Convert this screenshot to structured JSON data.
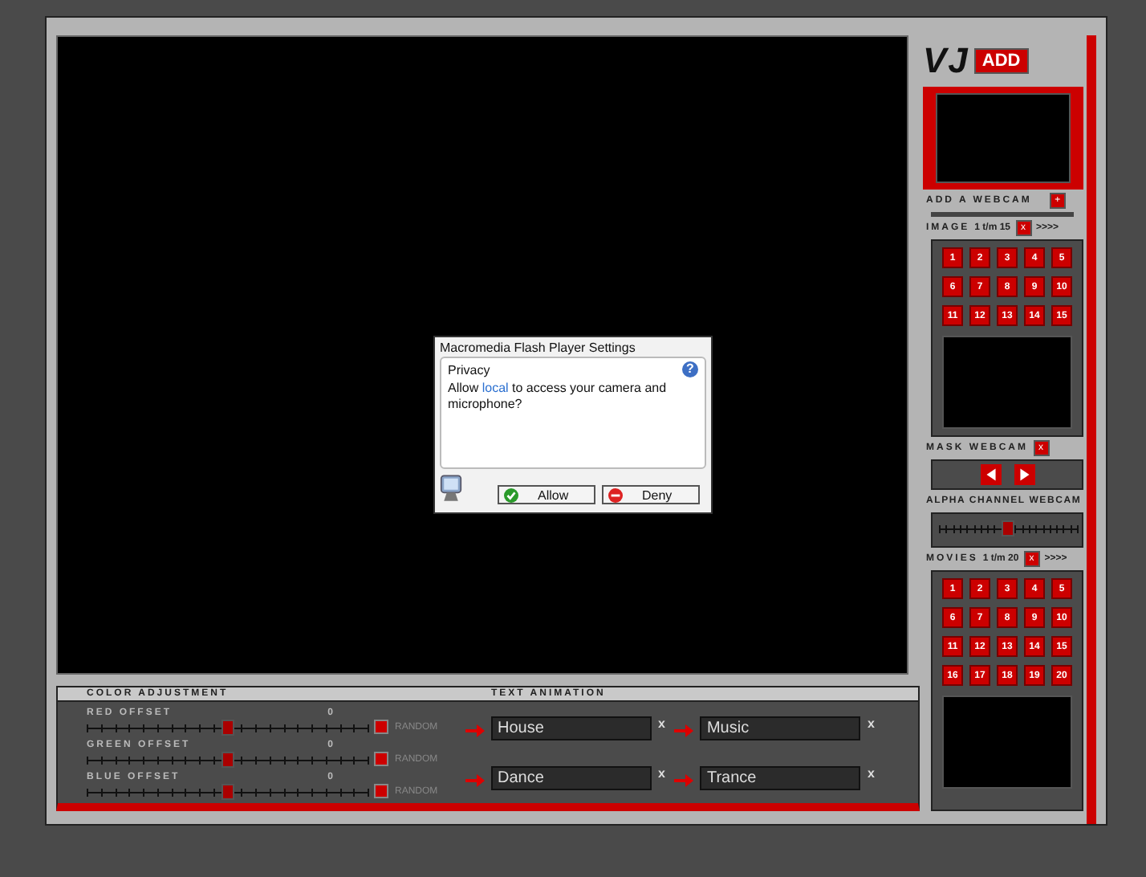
{
  "logo": {
    "text": "VJ",
    "badge": "ADD"
  },
  "dialog": {
    "title": "Macromedia Flash Player Settings",
    "heading": "Privacy",
    "prompt_before": "Allow ",
    "prompt_link": "local",
    "prompt_after": " to access your camera and microphone?",
    "help": "?",
    "allow": "Allow",
    "deny": "Deny"
  },
  "webcam": {
    "label": "ADD A WEBCAM",
    "add": "+"
  },
  "image": {
    "label": "IMAGE",
    "range": "1 t/m 15",
    "close": "x",
    "more": ">>>>",
    "buttons": [
      "1",
      "2",
      "3",
      "4",
      "5",
      "6",
      "7",
      "8",
      "9",
      "10",
      "11",
      "12",
      "13",
      "14",
      "15"
    ]
  },
  "mask": {
    "label": "MASK WEBCAM",
    "close": "x"
  },
  "alpha": {
    "label": "ALPHA CHANNEL WEBCAM",
    "level": 0.5
  },
  "movies": {
    "label": "MOVIES",
    "range": "1 t/m 20",
    "close": "x",
    "more": ">>>>",
    "buttons": [
      "1",
      "2",
      "3",
      "4",
      "5",
      "6",
      "7",
      "8",
      "9",
      "10",
      "11",
      "12",
      "13",
      "14",
      "15",
      "16",
      "17",
      "18",
      "19",
      "20"
    ]
  },
  "color_adjustment": {
    "title": "COLOR ADJUSTMENT",
    "sliders": [
      {
        "name": "RED OFFSET",
        "value": "0",
        "level": 0.5,
        "random": "RANDOM",
        "checked": false
      },
      {
        "name": "GREEN OFFSET",
        "value": "0",
        "level": 0.5,
        "random": "RANDOM",
        "checked": false
      },
      {
        "name": "BLUE OFFSET",
        "value": "0",
        "level": 0.5,
        "random": "RANDOM",
        "checked": false
      }
    ]
  },
  "text_animation": {
    "title": "TEXT ANIMATION",
    "fields": [
      {
        "value": "House",
        "remove": "x"
      },
      {
        "value": "Music",
        "remove": "x"
      },
      {
        "value": "Dance",
        "remove": "x"
      },
      {
        "value": "Trance",
        "remove": "x"
      }
    ]
  }
}
